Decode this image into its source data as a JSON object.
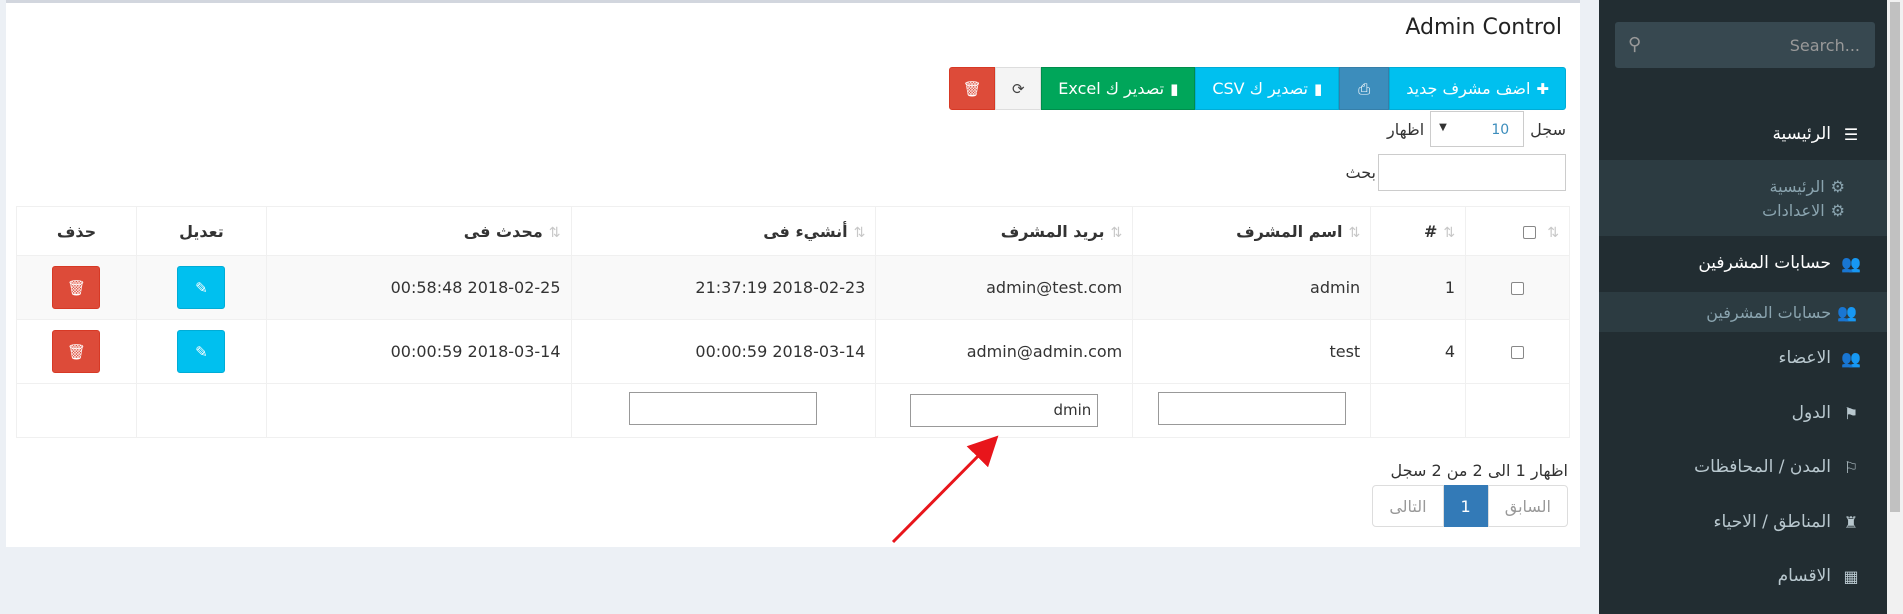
{
  "panel": {
    "title": "Admin Control"
  },
  "toolbar": {
    "add_label": "اضف مشرف جديد",
    "csv_label": "تصدير ك CSV",
    "excel_label": "تصدير ك Excel"
  },
  "length": {
    "show": "اظهار",
    "value": "10",
    "records": "سجل"
  },
  "search": {
    "label": "بحث"
  },
  "table": {
    "headers": [
      "#",
      "اسم المشرف",
      "بريد المشرف",
      "أنشيء فى",
      "محدث فى",
      "تعديل",
      "حذف"
    ],
    "rows": [
      {
        "id": "1",
        "name": "admin",
        "email": "admin@test.com",
        "created": "2018-02-23 21:37:19",
        "updated": "2018-02-25 00:58:48"
      },
      {
        "id": "4",
        "name": "test",
        "email": "admin@admin.com",
        "created": "2018-03-14 00:00:59",
        "updated": "2018-03-14 00:00:59"
      }
    ],
    "filter": {
      "name": "",
      "email": "dmin",
      "created": ""
    }
  },
  "info": "اظهار 1 الى 2 من 2 سجل",
  "pager": {
    "prev": "السابق",
    "current": "1",
    "next": "التالى"
  },
  "sidebar": {
    "search_placeholder": "Search...",
    "items": [
      {
        "label": "الرئيسية",
        "icon": "list-icon"
      },
      {
        "label": "الرئيسية",
        "icon": "gear-icon"
      },
      {
        "label": "الاعدادات",
        "icon": "gears-icon"
      },
      {
        "label": "حسابات المشرفين",
        "icon": "users-icon"
      },
      {
        "label": "حسابات المشرفين",
        "icon": "users-icon"
      },
      {
        "label": "الاعضاء",
        "icon": "users-icon"
      },
      {
        "label": "الدول",
        "icon": "flag-icon"
      },
      {
        "label": "المدن / المحافظات",
        "icon": "flag-checkered-icon"
      },
      {
        "label": "المناطق / الاحياء",
        "icon": "fort-icon"
      },
      {
        "label": "الاقسام",
        "icon": "grid-icon"
      }
    ]
  },
  "colors": {
    "accent_blue": "#00c0ef",
    "green": "#00a65a",
    "red": "#dd4b39",
    "sidebar": "#222d32",
    "arrow": "#e8151b"
  }
}
